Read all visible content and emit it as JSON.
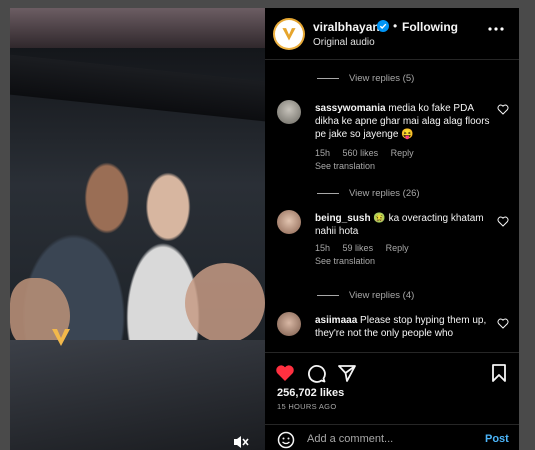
{
  "header": {
    "username": "viralbhayani",
    "separator": "•",
    "follow_status": "Following",
    "audio": "Original audio",
    "brand_color": "#f2b84b"
  },
  "comments": [
    {
      "type": "replies",
      "label": "View replies (5)"
    },
    {
      "type": "comment",
      "user": "sassywomania",
      "text": "media ko fake PDA dikha ke apne ghar mai alag alag floors pe jake so jayenge 😝",
      "age": "15h",
      "likes": "560 likes",
      "reply": "Reply",
      "translate": "See translation"
    },
    {
      "type": "replies",
      "label": "View replies (26)"
    },
    {
      "type": "comment",
      "user": "being_sush",
      "text": "🤢 ka overacting khatam nahii hota",
      "age": "15h",
      "likes": "59 likes",
      "reply": "Reply",
      "translate": "See translation"
    },
    {
      "type": "replies",
      "label": "View replies (4)"
    },
    {
      "type": "comment",
      "user": "asiimaaa",
      "text": "Please stop hyping them up, they're not the only people who"
    }
  ],
  "post": {
    "likes": "256,702 likes",
    "time": "15 HOURS AGO",
    "liked_color": "#ff3040"
  },
  "composer": {
    "placeholder": "Add a comment...",
    "post_label": "Post",
    "post_color": "#4cb5f9"
  },
  "icons": [
    "verified-icon",
    "more-icon",
    "heart-icon",
    "comment-icon",
    "share-icon",
    "bookmark-icon",
    "emoji-icon",
    "mute-icon"
  ]
}
